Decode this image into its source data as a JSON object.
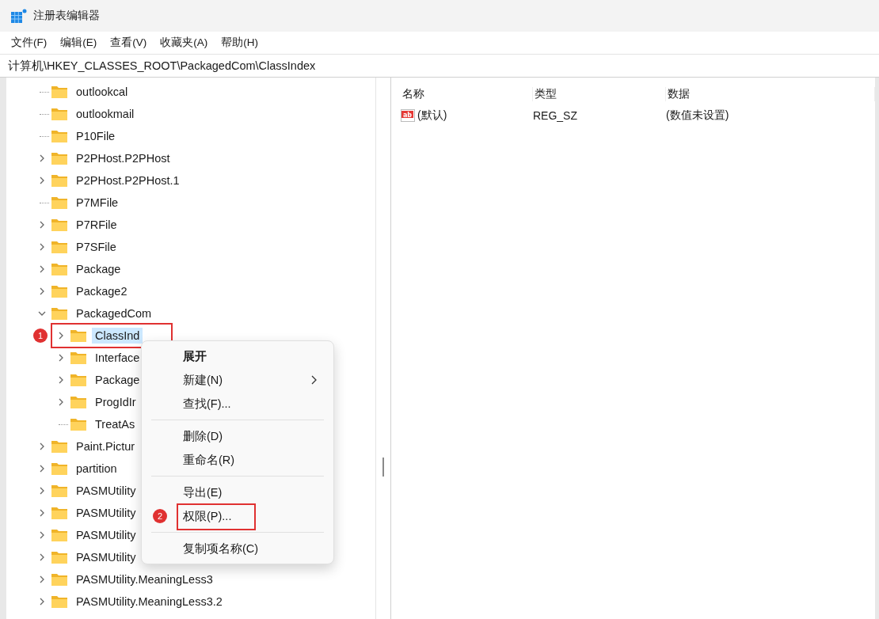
{
  "window": {
    "title": "注册表编辑器"
  },
  "menu": [
    "文件(F)",
    "编辑(E)",
    "查看(V)",
    "收藏夹(A)",
    "帮助(H)"
  ],
  "address": "计算机\\HKEY_CLASSES_ROOT\\PackagedCom\\ClassIndex",
  "tree": [
    {
      "label": "outlookcal",
      "expandable": false,
      "selected": false
    },
    {
      "label": "outlookmail",
      "expandable": false,
      "selected": false
    },
    {
      "label": "P10File",
      "expandable": false,
      "selected": false
    },
    {
      "label": "P2PHost.P2PHost",
      "expandable": true,
      "expanded": false,
      "selected": false
    },
    {
      "label": "P2PHost.P2PHost.1",
      "expandable": true,
      "expanded": false,
      "selected": false
    },
    {
      "label": "P7MFile",
      "expandable": false,
      "selected": false
    },
    {
      "label": "P7RFile",
      "expandable": true,
      "expanded": false,
      "selected": false
    },
    {
      "label": "P7SFile",
      "expandable": true,
      "expanded": false,
      "selected": false
    },
    {
      "label": "Package",
      "expandable": true,
      "expanded": false,
      "selected": false
    },
    {
      "label": "Package2",
      "expandable": true,
      "expanded": false,
      "selected": false
    },
    {
      "label": "PackagedCom",
      "expandable": true,
      "expanded": true,
      "selected": false,
      "children": [
        {
          "label": "ClassInd",
          "expandable": true,
          "expanded": false,
          "selected": true,
          "annotation": "1"
        },
        {
          "label": "Interface",
          "expandable": true,
          "expanded": false,
          "selected": false
        },
        {
          "label": "Package",
          "expandable": true,
          "expanded": false,
          "selected": false
        },
        {
          "label": "ProgIdIr",
          "expandable": true,
          "expanded": false,
          "selected": false
        },
        {
          "label": "TreatAs",
          "expandable": false,
          "selected": false
        }
      ]
    },
    {
      "label": "Paint.Pictur",
      "expandable": true,
      "expanded": false,
      "selected": false
    },
    {
      "label": "partition",
      "expandable": true,
      "expanded": false,
      "selected": false
    },
    {
      "label": "PASMUtility",
      "expandable": true,
      "expanded": false,
      "selected": false
    },
    {
      "label": "PASMUtility",
      "expandable": true,
      "expanded": false,
      "selected": false
    },
    {
      "label": "PASMUtility",
      "expandable": true,
      "expanded": false,
      "selected": false
    },
    {
      "label": "PASMUtility",
      "expandable": true,
      "expanded": false,
      "selected": false
    },
    {
      "label": "PASMUtility.MeaningLess3",
      "expandable": true,
      "expanded": false,
      "selected": false
    },
    {
      "label": "PASMUtility.MeaningLess3.2",
      "expandable": true,
      "expanded": false,
      "selected": false
    }
  ],
  "values": {
    "columns": [
      "名称",
      "类型",
      "数据"
    ],
    "rows": [
      {
        "icon_text": "ab",
        "name": "(默认)",
        "type": "REG_SZ",
        "data": "(数值未设置)"
      }
    ]
  },
  "context_menu": [
    {
      "kind": "default",
      "label": "展开"
    },
    {
      "kind": "submenu",
      "label": "新建(N)"
    },
    {
      "kind": "item",
      "label": "查找(F)..."
    },
    {
      "kind": "separator"
    },
    {
      "kind": "item",
      "label": "删除(D)"
    },
    {
      "kind": "item",
      "label": "重命名(R)"
    },
    {
      "kind": "separator"
    },
    {
      "kind": "item",
      "label": "导出(E)"
    },
    {
      "kind": "item",
      "label": "权限(P)...",
      "annotation": "2"
    },
    {
      "kind": "separator"
    },
    {
      "kind": "item",
      "label": "复制项名称(C)"
    }
  ]
}
